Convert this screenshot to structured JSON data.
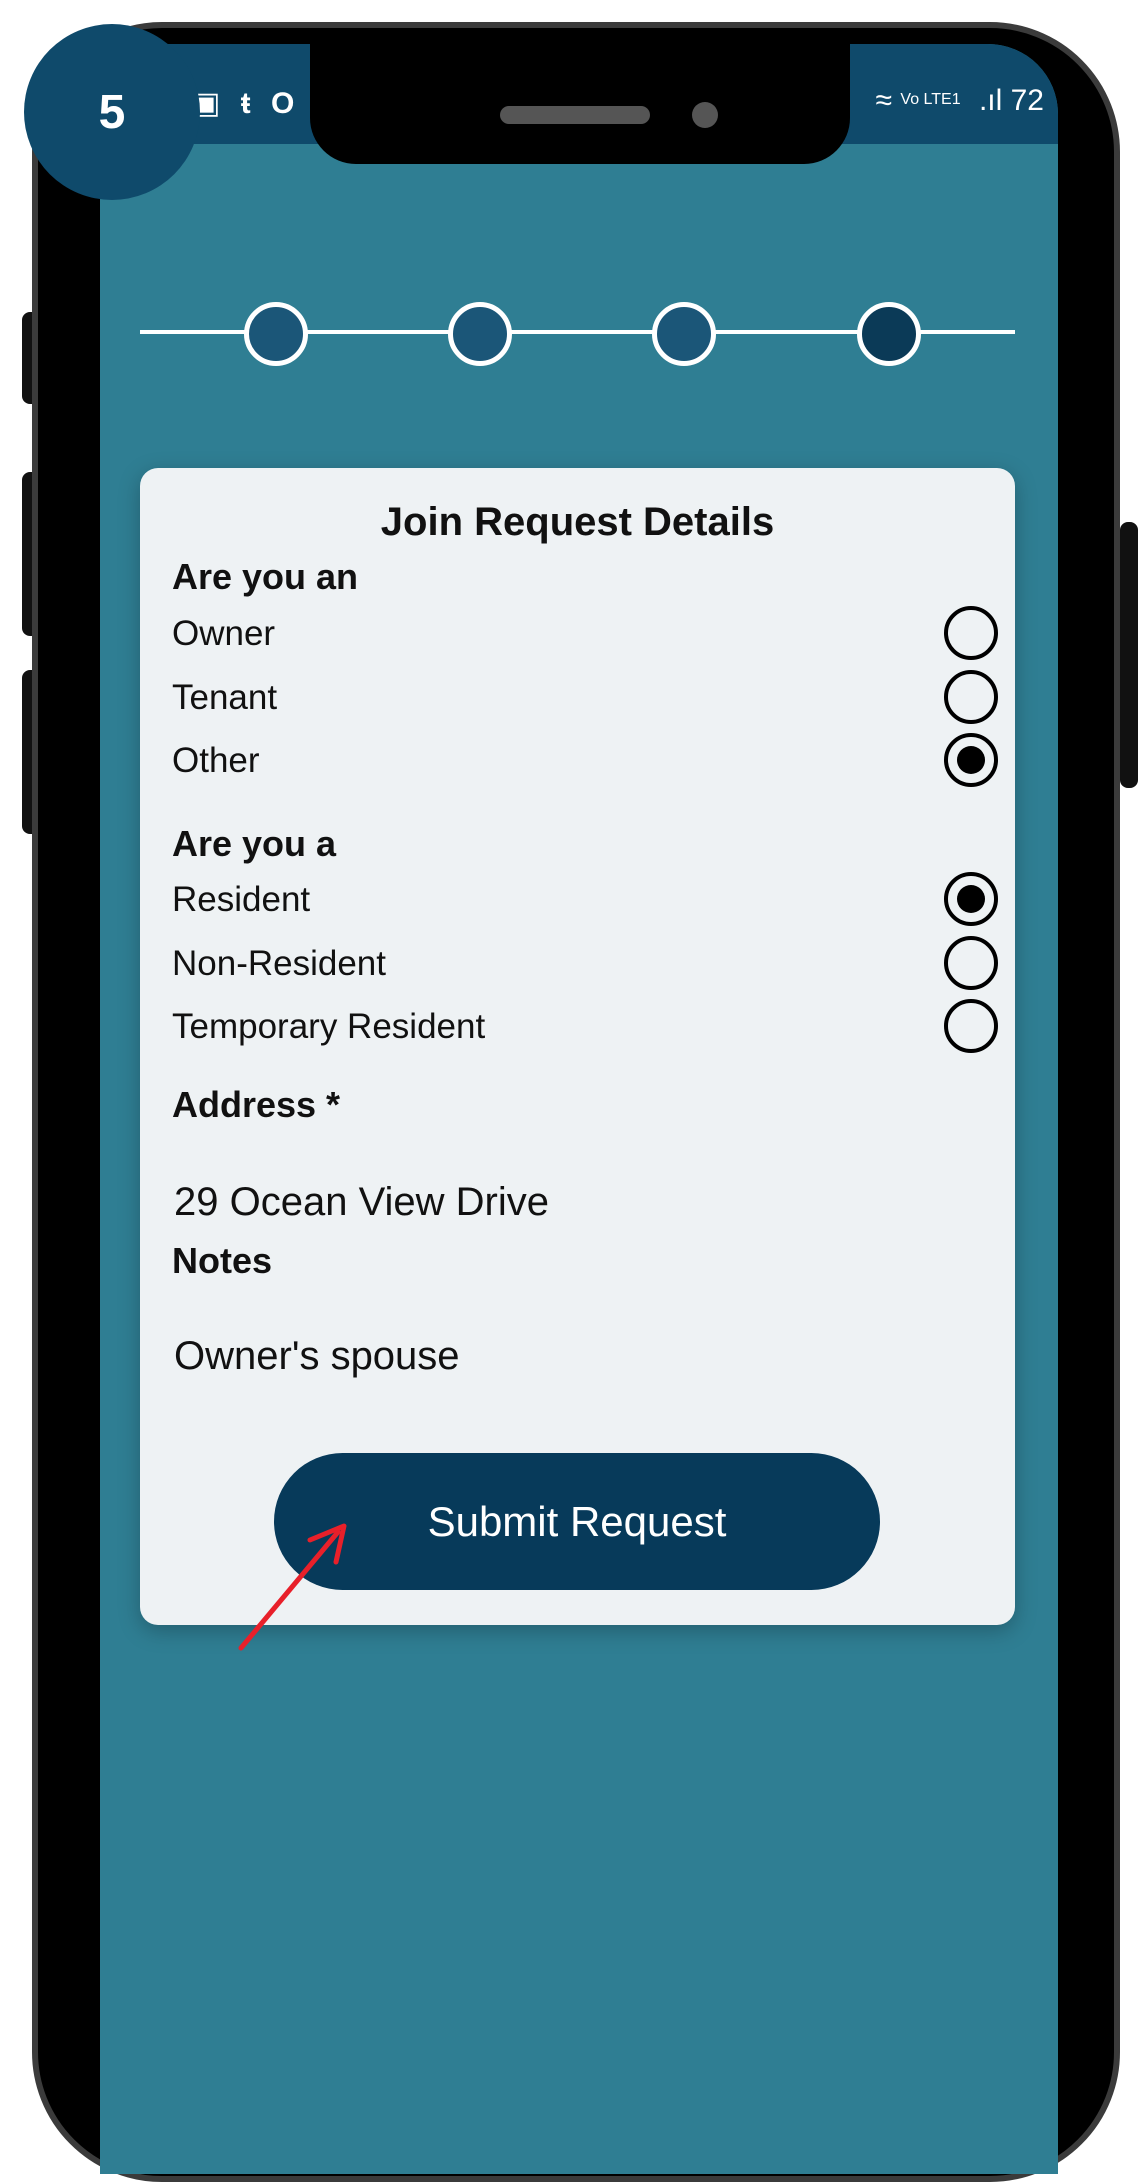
{
  "step_badge": "5",
  "status_bar": {
    "left_icons": [
      "image-icon",
      "teams-icon",
      "circle-icon"
    ],
    "left_glyphs": "▣ ŧ O",
    "network_small": "Vo LTE1",
    "signal": ".ıl",
    "time_fragment": "72"
  },
  "stepper": {
    "total_steps": 4,
    "current_step": 4
  },
  "card": {
    "title": "Join Request Details",
    "section1_label": "Are you an",
    "section1_options": [
      {
        "label": "Owner",
        "selected": false
      },
      {
        "label": "Tenant",
        "selected": false
      },
      {
        "label": "Other",
        "selected": true
      }
    ],
    "section2_label": "Are you a",
    "section2_options": [
      {
        "label": "Resident",
        "selected": true
      },
      {
        "label": "Non-Resident",
        "selected": false
      },
      {
        "label": "Temporary Resident",
        "selected": false
      }
    ],
    "address_label": "Address *",
    "address_value": "29 Ocean View Drive",
    "notes_label": "Notes",
    "notes_value": "Owner's spouse",
    "submit_label": "Submit Request"
  },
  "colors": {
    "screen_bg": "#2f7e93",
    "status_bar": "#0f4a6b",
    "button": "#073a5a",
    "annotation_arrow": "#e8202a"
  }
}
